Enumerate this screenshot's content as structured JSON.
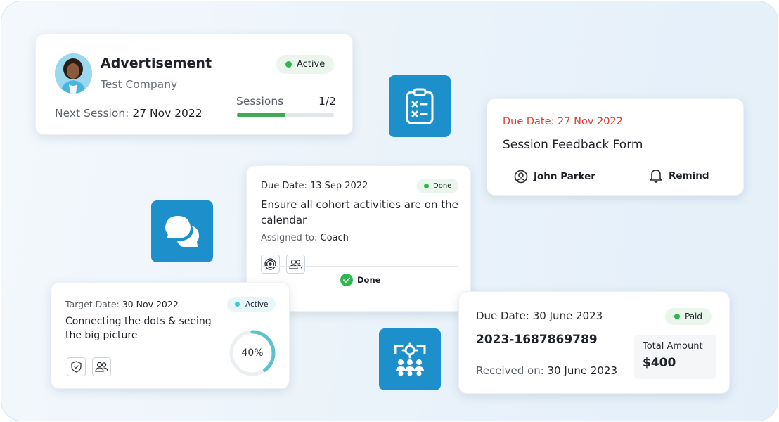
{
  "advert_card": {
    "title": "Advertisement",
    "company": "Test Company",
    "status": "Active",
    "next_session_label": "Next Session:",
    "next_session_date": "27 Nov 2022",
    "sessions_label": "Sessions",
    "sessions_count": "1/2",
    "sessions_progress": 0.5
  },
  "feedback_card": {
    "due_date": "Due Date: 27 Nov 2022",
    "title": "Session Feedback Form",
    "person": "John Parker",
    "remind_label": "Remind"
  },
  "task_card": {
    "due_date": "Due Date: 13 Sep 2022",
    "status": "Done",
    "title": "Ensure all cohort activities are on the calendar",
    "assigned_label": "Assigned to:",
    "assigned_to": "Coach",
    "done_label": "Done"
  },
  "goal_card": {
    "target_label": "Target Date:",
    "target_date": "30 Nov 2022",
    "status": "Active",
    "title": "Connecting the dots & seeing the big picture",
    "progress_label": "40%",
    "progress": 0.4
  },
  "invoice_card": {
    "due_date": "Due Date: 30 June 2023",
    "status": "Paid",
    "invoice_number": "2023-1687869789",
    "received_label": "Received on:",
    "received_date": "30 June 2023",
    "total_label": "Total Amount",
    "total_amount": "$400"
  },
  "tiles": {
    "clipboard": "clipboard-checklist-icon",
    "chat": "chat-bubbles-icon",
    "team": "team-settings-icon"
  },
  "colors": {
    "accent": "#1d8fcb",
    "success": "#2db84d",
    "cyan": "#3ec6d9",
    "danger": "#e03a2f"
  }
}
